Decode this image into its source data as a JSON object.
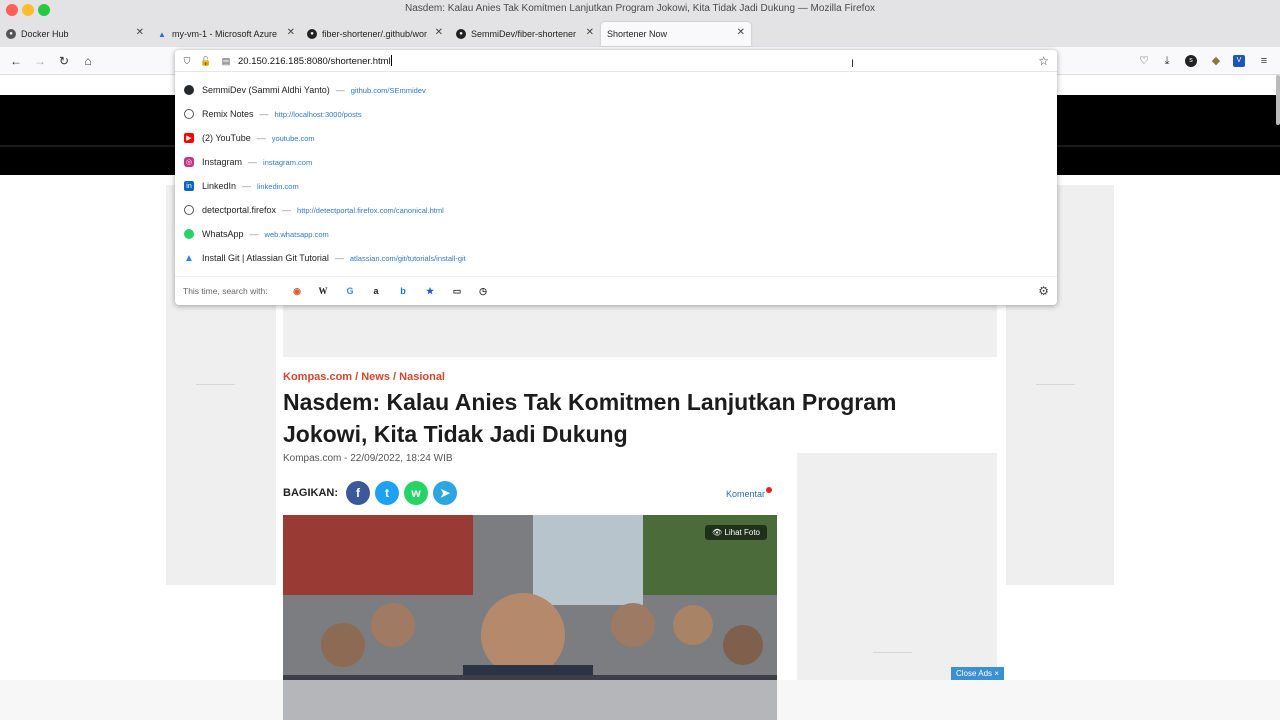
{
  "window": {
    "title": "Nasdem: Kalau Anies Tak Komitmen Lanjutkan Program Jokowi, Kita Tidak Jadi Dukung — Mozilla Firefox"
  },
  "tabs": [
    {
      "label": "Docker Hub",
      "icon": "docker-icon"
    },
    {
      "label": "my-vm-1 - Microsoft Azure",
      "icon": "azure-icon"
    },
    {
      "label": "fiber-shortener/.github/wor",
      "icon": "github-icon"
    },
    {
      "label": "SemmiDev/fiber-shortener",
      "icon": "github-icon"
    },
    {
      "label": "Shortener Now",
      "icon": ""
    }
  ],
  "urlbar": {
    "value": "20.150.216.185:8080/shortener.html"
  },
  "suggestions": [
    {
      "title": "SemmiDev (Sammi Aldhi Yanto)",
      "url": "github.com/SEmmidev",
      "icon": "github-icon",
      "color": "#24292e"
    },
    {
      "title": "Remix Notes",
      "url": "http://localhost:3000/posts",
      "icon": "globe-icon",
      "color": "#555555"
    },
    {
      "title": "(2) YouTube",
      "url": "youtube.com",
      "icon": "youtube-icon",
      "color": "#ff0000"
    },
    {
      "title": "Instagram",
      "url": "instagram.com",
      "icon": "instagram-icon",
      "color": "#c13584"
    },
    {
      "title": "LinkedIn",
      "url": "linkedin.com",
      "icon": "linkedin-icon",
      "color": "#0a66c2"
    },
    {
      "title": "detectportal.firefox",
      "url": "http://detectportal.firefox.com/canonical.html",
      "icon": "globe-icon",
      "color": "#555555"
    },
    {
      "title": "WhatsApp",
      "url": "web.whatsapp.com",
      "icon": "whatsapp-icon",
      "color": "#25d366"
    },
    {
      "title": "Install Git | Atlassian Git Tutorial",
      "url": "atlassian.com/git/tutorials/install-git",
      "icon": "atlassian-icon",
      "color": "#2684ff"
    }
  ],
  "search_with": {
    "label": "This time, search with:"
  },
  "article": {
    "breadcrumb": "Kompas.com / News / Nasional",
    "headline": "Nasdem: Kalau Anies Tak Komitmen Lanjutkan Program Jokowi, Kita Tidak Jadi Dukung",
    "meta": "Kompas.com - 22/09/2022, 18:24 WIB",
    "share_label": "BAGIKAN:",
    "comment_label": "Komentar",
    "photo_button": "Lihat Foto",
    "close_ads": "Close Ads ×"
  },
  "colors": {
    "accent_red": "#d2462b",
    "link_blue": "#2f78c9"
  }
}
